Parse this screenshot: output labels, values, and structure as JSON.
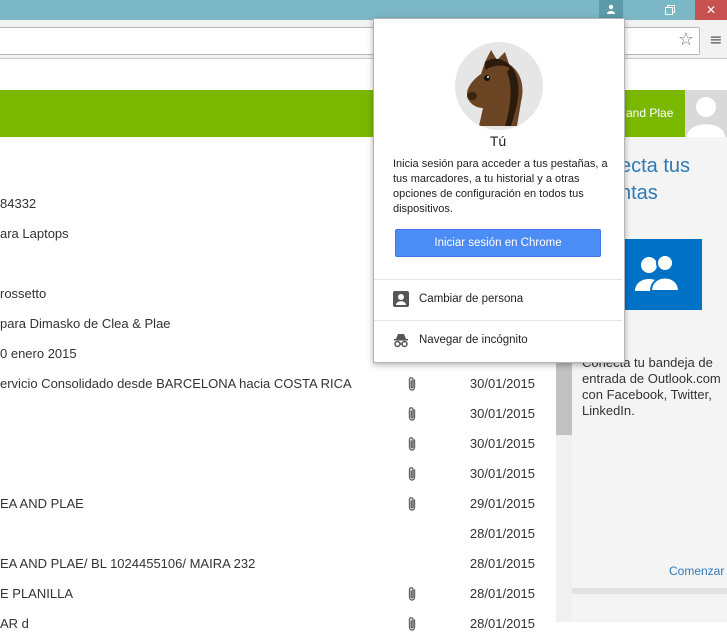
{
  "popup": {
    "name": "Tú",
    "description": "Inicia sesión para acceder a tus pestañas, a tus marcadores, a tu historial y a otras opciones de configuración en todos tus dispositivos.",
    "signin_label": "Iniciar sesión en Chrome",
    "switch_person_label": "Cambiar de persona",
    "incognito_label": "Navegar de incógnito"
  },
  "header": {
    "user_name": "and Plae"
  },
  "right_pane": {
    "title_line1": "ecta tus",
    "title_line2": "ntas",
    "description": "Conecta tu bandeja de entrada de Outlook.com con Facebook, Twitter, LinkedIn.",
    "cta_label": "Comenzar"
  },
  "mail_rows": [
    {
      "subject": "84332",
      "date": "",
      "attachment": false
    },
    {
      "subject": "ara Laptops",
      "date": "",
      "attachment": false
    },
    {
      "subject": "",
      "date": "",
      "attachment": false
    },
    {
      "subject": " rossetto",
      "date": "",
      "attachment": false
    },
    {
      "subject": "para Dimasko de Clea & Plae",
      "date": "",
      "attachment": false
    },
    {
      "subject": "0 enero 2015",
      "date": "",
      "attachment": false
    },
    {
      "subject": "ervicio Consolidado desde BARCELONA hacia COSTA RICA",
      "date": "30/01/2015",
      "attachment": true
    },
    {
      "subject": "",
      "date": "30/01/2015",
      "attachment": true
    },
    {
      "subject": "",
      "date": "30/01/2015",
      "attachment": true
    },
    {
      "subject": "",
      "date": "30/01/2015",
      "attachment": true
    },
    {
      "subject": "EA AND PLAE",
      "date": "29/01/2015",
      "attachment": true
    },
    {
      "subject": "",
      "date": "28/01/2015",
      "attachment": false
    },
    {
      "subject": "EA AND PLAE/ BL 1024455106/ MAIRA 232",
      "date": "28/01/2015",
      "attachment": false
    },
    {
      "subject": "E PLANILLA",
      "date": "28/01/2015",
      "attachment": true
    },
    {
      "subject": "AR d",
      "date": "28/01/2015",
      "attachment": true
    }
  ],
  "colors": {
    "titlebar": "#7bb7c4",
    "header_green": "#7ab800",
    "signin_blue": "#4c8cf5",
    "link_blue": "#2e7ab8",
    "people_tile": "#0072c6"
  },
  "icons": {
    "star": "star-icon",
    "menu": "hamburger-menu-icon",
    "attachment": "paperclip-icon",
    "profile": "person-icon",
    "incognito": "incognito-icon"
  }
}
